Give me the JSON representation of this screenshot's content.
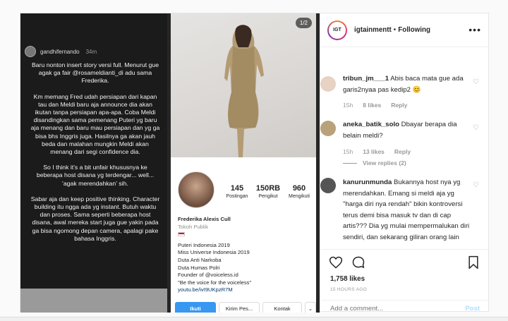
{
  "story": {
    "username": "gandhifernando",
    "time": "34m",
    "paragraphs": [
      "Baru nonton insert story versi full. Menurut gue agak ga fair @rosameldianti_di adu sama Frederika.",
      "Km memang Fred udah persiapan dari kapan tau dan Meldi baru aja announce dia akan ikutan tanpa persiapan apa-apa. Coba Meldi disandingkan sama pemenang Puteri yg baru aja menang dan baru mau persiapan dan yg ga bisa bhs Inggris juga. Hasilnya ga akan jauh beda dan malahan mungkin Meldi akan menang dari segi confidence dia.",
      "So I think it's a bit unfair khususnya ke beberapa host disana yg terdengar... well... 'agak merendahkan' sih.",
      "Sabar aja dan keep positive thinking. Character building itu ngga ada yg instant. Butuh waktu dan proses. Sama seperti beberapa host disana, awal mereka start juga gue yakin pada ga bisa ngomong depan camera, apalagi pake bahasa Inggris."
    ]
  },
  "photo": {
    "counter": "1/2"
  },
  "profile": {
    "stats": [
      {
        "num": "145",
        "label": "Postingan"
      },
      {
        "num": "150RB",
        "label": "Pengikut"
      },
      {
        "num": "960",
        "label": "Mengikuti"
      }
    ],
    "name": "Frederika Alexis Cull",
    "category": "Tokoh Publik",
    "bio_lines": [
      "Puteri Indonesia 2019",
      "Miss Universe Indonesia 2019",
      "Duta Anti Narkoba",
      "Duta Humas Polri",
      "Founder of @voiceless.id",
      "\"Be the voice for the voiceless\""
    ],
    "link": "youtu.be/ivI9UKpzR7M",
    "buttons": {
      "follow": "Ikuti",
      "message": "Kirim Pes...",
      "contact": "Kontak",
      "more": "⌄"
    }
  },
  "header": {
    "username": "igtainmentt",
    "separator": "•",
    "following": "Following",
    "more": "•••",
    "avatar_text": "IGT"
  },
  "comments": [
    {
      "user": "tribun_jm___1",
      "text": "Abis baca mata gue ada garis2nyaa pas kedip2 😊",
      "time": "15h",
      "likes": "8 likes",
      "reply": "Reply",
      "replies": "",
      "avatar_color": "#e8d2c4"
    },
    {
      "user": "aneka_batik_solo",
      "text": "Dbayar berapa dia belain meldi?",
      "time": "15h",
      "likes": "13 likes",
      "reply": "Reply",
      "replies": "View replies (2)",
      "avatar_color": "#b9a27a"
    },
    {
      "user": "kanurunmunda",
      "text": "Bukannya host nya yg merendahkan. Emang si meldi aja yg \"harga diri nya rendah\" bikin kontroversi terus demi bisa masuk tv dan di cap artis??? Dia yg mulai mempermalukan diri sendiri, dan sekarang giliran orang lain",
      "time": "",
      "likes": "",
      "reply": "",
      "replies": "",
      "avatar_color": "#555555"
    }
  ],
  "actions": {
    "likes": "1,758 likes",
    "posted": "15 HOURS AGO",
    "add_comment_placeholder": "Add a comment...",
    "post": "Post"
  },
  "colors": {
    "accent": "#3897f0",
    "muted": "#999999",
    "text": "#262626"
  }
}
